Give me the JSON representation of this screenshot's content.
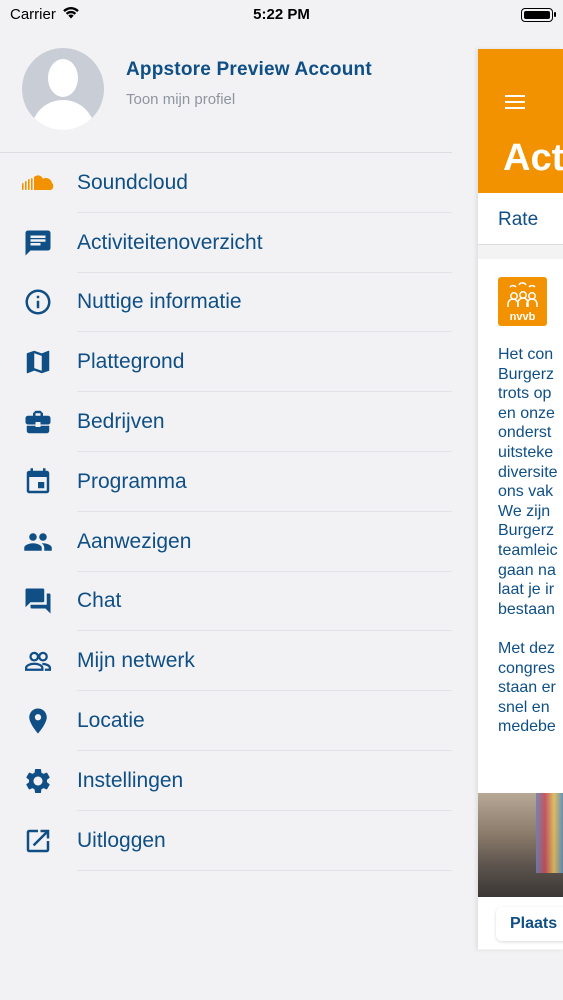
{
  "status_bar": {
    "carrier": "Carrier",
    "time": "5:22 PM"
  },
  "profile": {
    "name": "Appstore Preview Account",
    "subtitle": "Toon mijn profiel"
  },
  "menu": [
    {
      "label": "Soundcloud",
      "icon": "soundcloud-icon"
    },
    {
      "label": "Activiteitenoverzicht",
      "icon": "feed-icon"
    },
    {
      "label": "Nuttige informatie",
      "icon": "info-icon"
    },
    {
      "label": "Plattegrond",
      "icon": "map-icon"
    },
    {
      "label": "Bedrijven",
      "icon": "briefcase-icon"
    },
    {
      "label": "Programma",
      "icon": "calendar-icon"
    },
    {
      "label": "Aanwezigen",
      "icon": "people-icon"
    },
    {
      "label": "Chat",
      "icon": "chat-icon"
    },
    {
      "label": "Mijn netwerk",
      "icon": "network-icon"
    },
    {
      "label": "Locatie",
      "icon": "location-pin-icon"
    },
    {
      "label": "Instellingen",
      "icon": "gear-icon"
    },
    {
      "label": "Uitloggen",
      "icon": "logout-icon"
    }
  ],
  "panel": {
    "title": "Act",
    "rate_label": "Rate",
    "logo_text": "nvvb",
    "post_text": "Het con\nBurgerz\ntrots op\nen onze\nonderst\nuitsteke\ndiversite\nons vak\nWe zijn\nBurgerz\nteamleic\ngaan na\nlaat je ir\nbestaan\n\nMet dez\ncongres\nstaan er\nsnel en\nmedebe",
    "place_button": "Plaats"
  },
  "colors": {
    "brand_blue": "#0f4f86",
    "accent_orange": "#f39200"
  }
}
